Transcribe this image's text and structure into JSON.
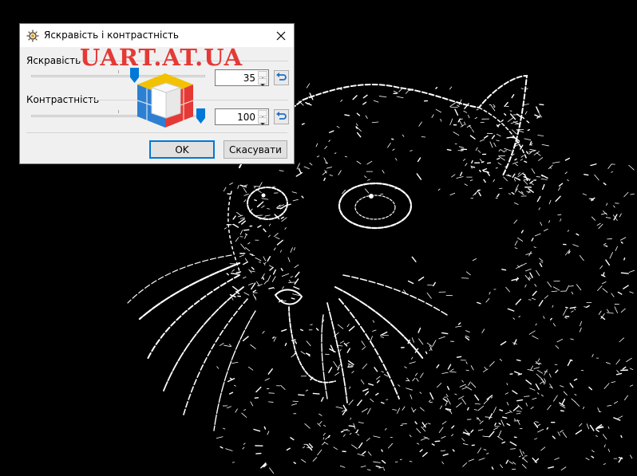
{
  "dialog": {
    "title": "Яскравість і контрастність",
    "brightness": {
      "label": "Яскравість",
      "value": "35",
      "level": 0.6
    },
    "contrast": {
      "label": "Контрастність",
      "value": "100",
      "level": 1.0
    },
    "ok_label": "OK",
    "cancel_label": "Скасувати"
  },
  "watermark": {
    "text": "UART.AT.UA"
  },
  "colors": {
    "background": "#000000",
    "accent": "#0078d7",
    "watermark": "#e53935"
  },
  "icons": {
    "app": "brightness-sun-icon",
    "close": "close-icon",
    "reset": "reset-arrow-icon",
    "spin_up": "arrow-up-icon",
    "spin_down": "arrow-down-icon"
  }
}
